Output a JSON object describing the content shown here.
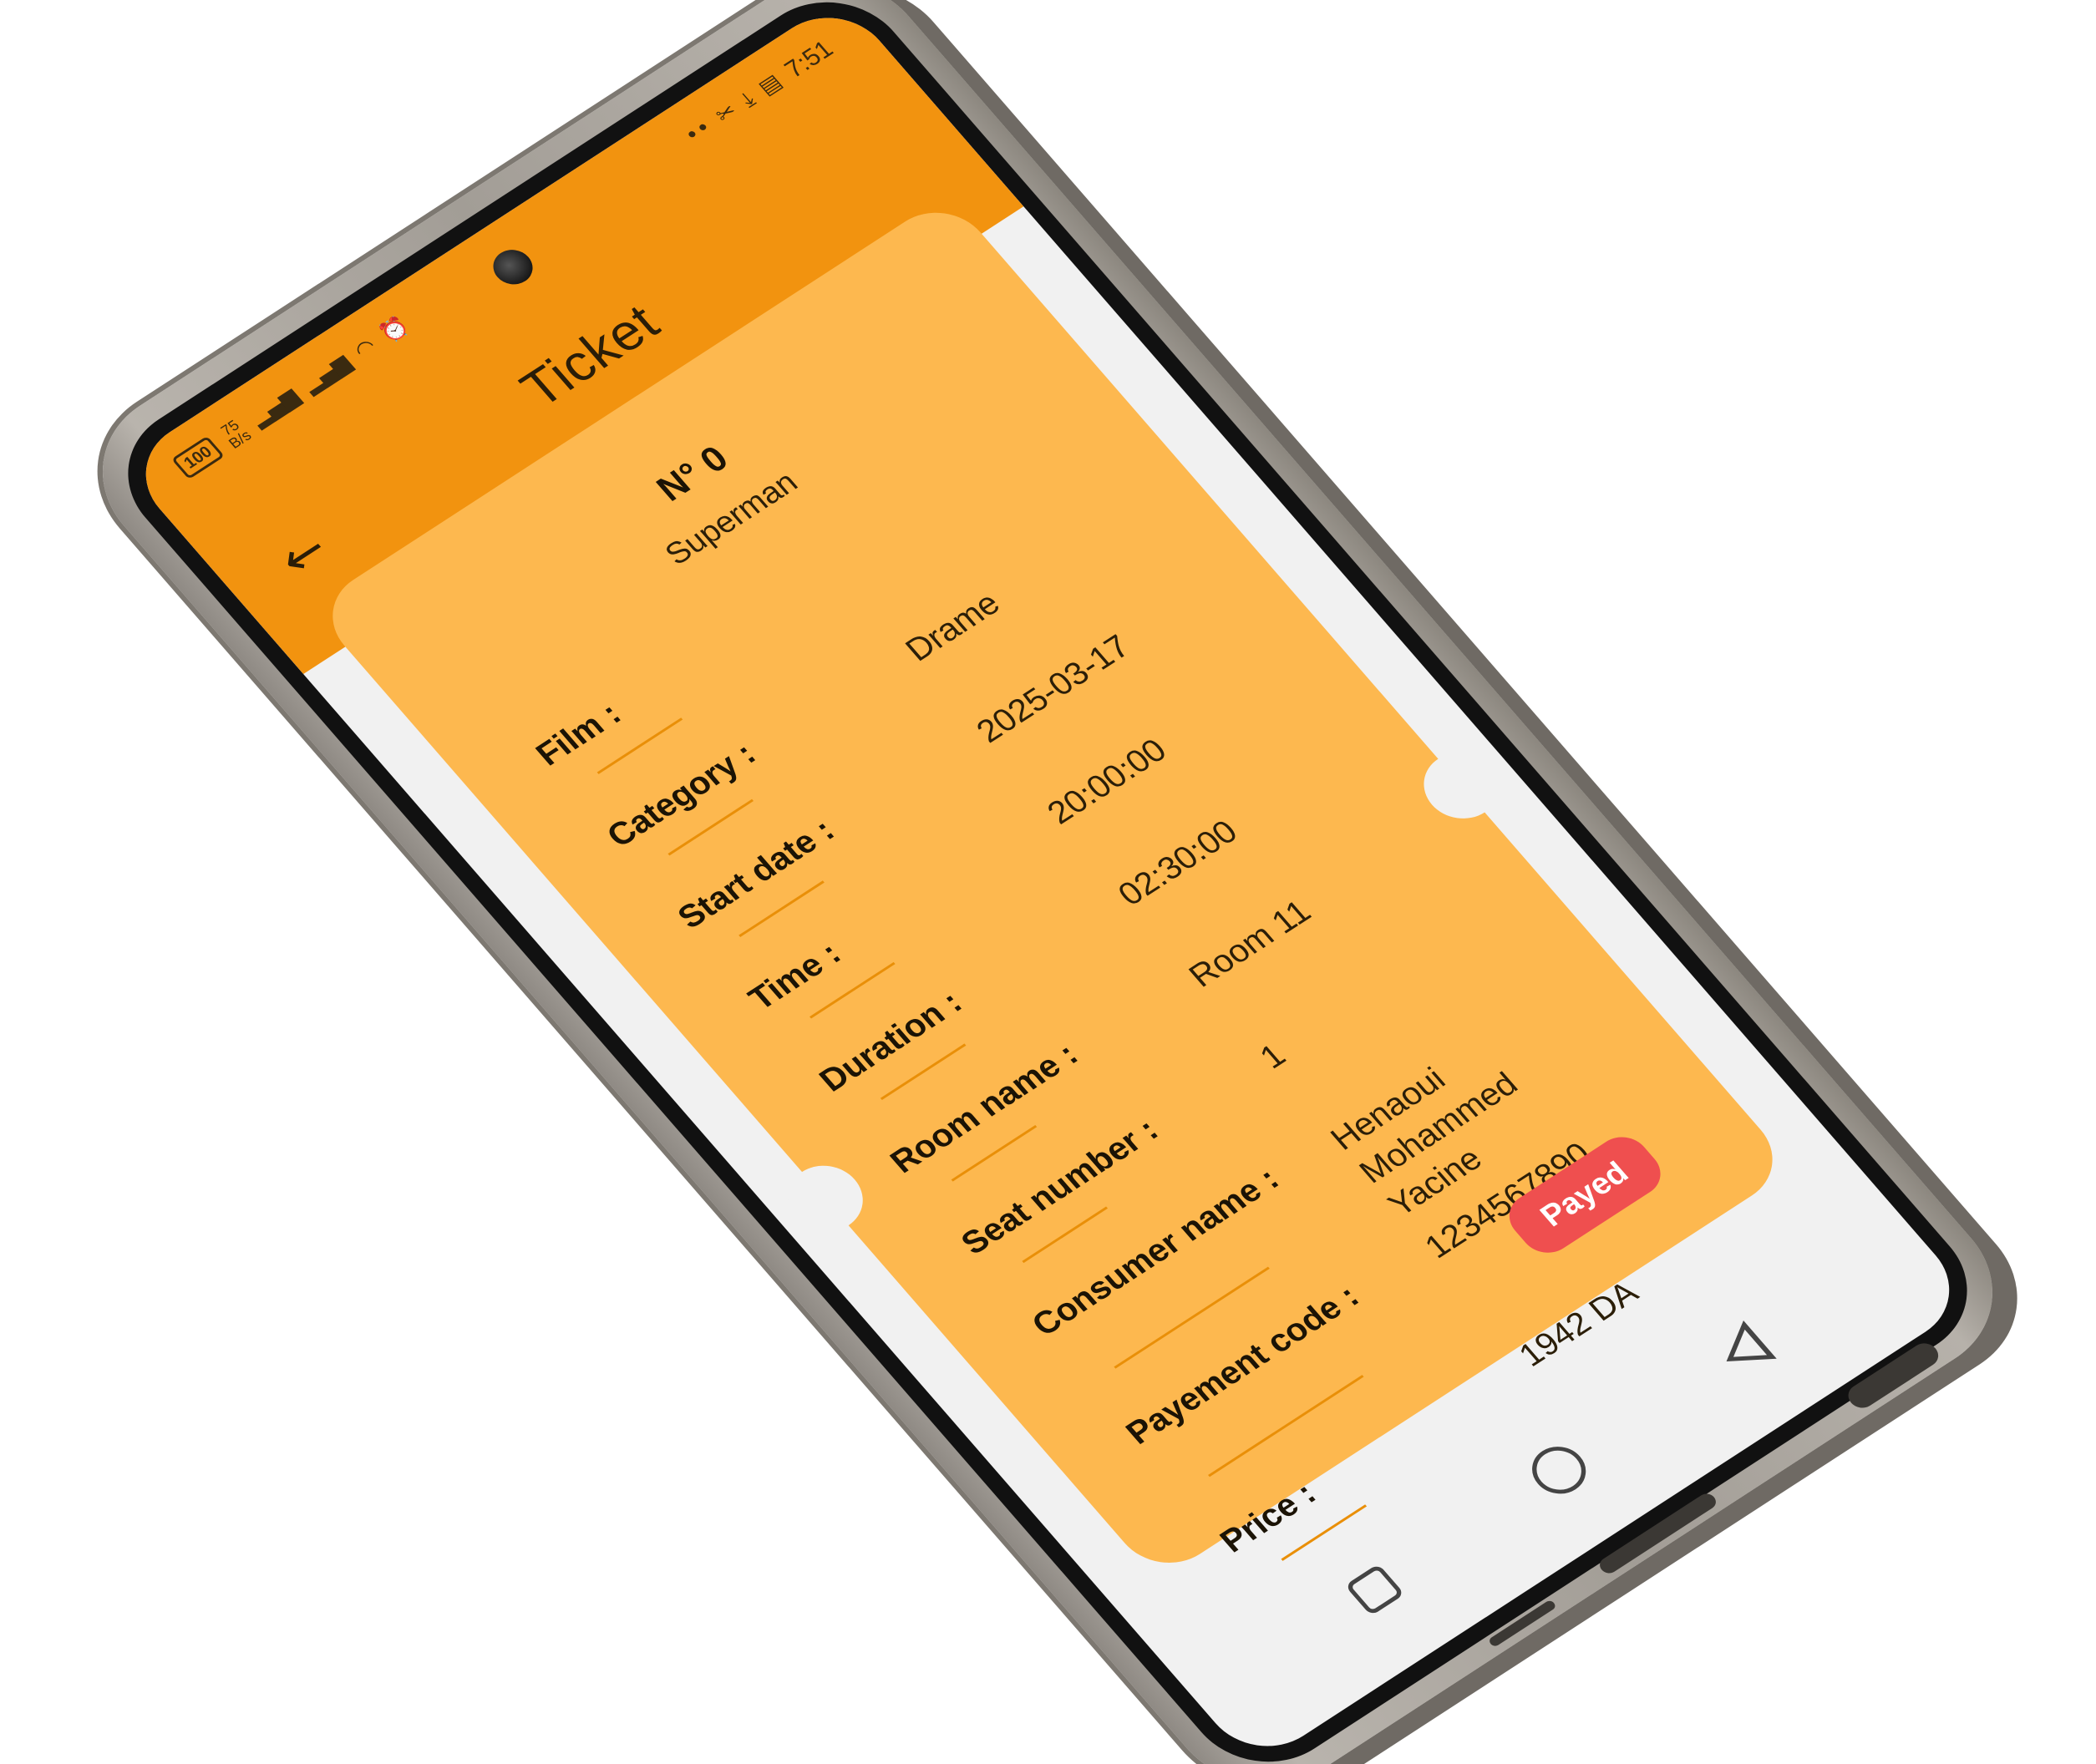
{
  "status_bar": {
    "battery": "100",
    "net_speed_value": "75",
    "net_speed_unit": "B/s",
    "time": "7:51"
  },
  "app_bar": {
    "title": "Ticket"
  },
  "ticket": {
    "number": "N° 0",
    "film_title": "Superman",
    "fields": [
      {
        "label": "Film :",
        "value": ""
      },
      {
        "label": "Category :",
        "value": "Drame"
      },
      {
        "label": "Start date :",
        "value": "2025-03-17"
      },
      {
        "label": "Time :",
        "value": "20:00:00"
      },
      {
        "label": "Duration :",
        "value": "02:30:00"
      },
      {
        "label": "Room name :",
        "value": "Room 11"
      },
      {
        "label": "Seat number :",
        "value": "1"
      },
      {
        "label": "Consumer name :",
        "value": "Henaoui Mohammed Yacine"
      },
      {
        "label": "Payement code :",
        "value": "1234567890"
      },
      {
        "label": "Price :",
        "value": "1942 DA"
      }
    ],
    "status_badge": "Payed"
  },
  "colors": {
    "app_bar": "#f2930f",
    "ticket": "#fdb84f",
    "badge": "#ef4f4f",
    "screen_bg": "#f1f1f1"
  },
  "icons": {
    "back": "arrow-left-icon",
    "nav_recent": "square-icon",
    "nav_home": "circle-icon",
    "nav_back": "triangle-icon"
  }
}
